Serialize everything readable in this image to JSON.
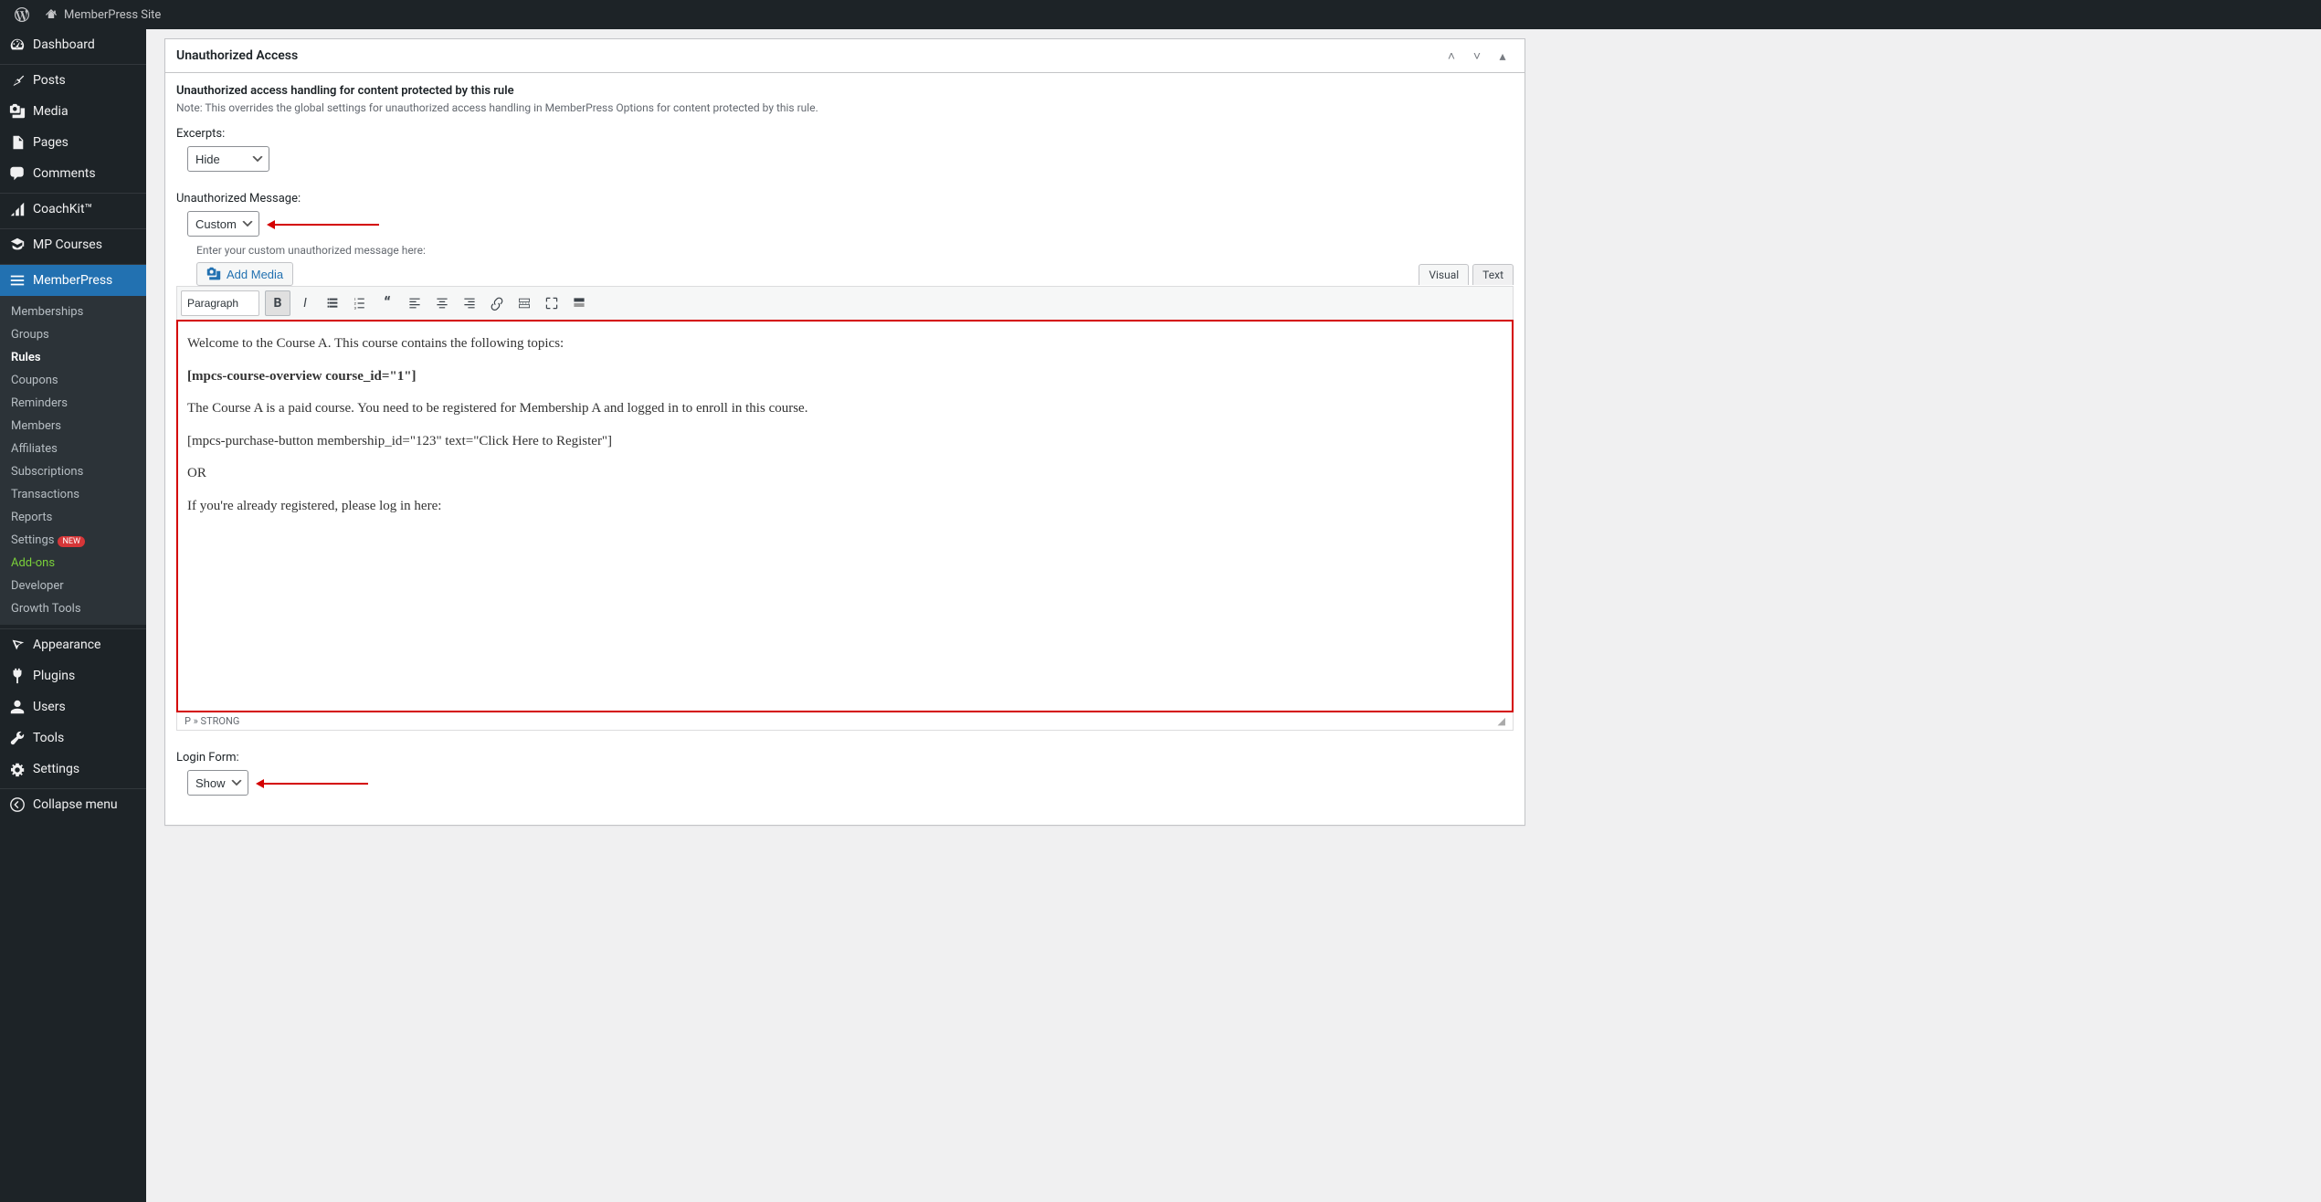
{
  "adminbar": {
    "site_name": "MemberPress Site"
  },
  "sidebar": {
    "items": [
      {
        "label": "Dashboard",
        "icon": "dashboard"
      },
      {
        "label": "Posts",
        "icon": "pin"
      },
      {
        "label": "Media",
        "icon": "media"
      },
      {
        "label": "Pages",
        "icon": "pages"
      },
      {
        "label": "Comments",
        "icon": "comments"
      },
      {
        "label": "CoachKit™",
        "icon": "chart"
      },
      {
        "label": "MP Courses",
        "icon": "courses"
      },
      {
        "label": "MemberPress",
        "icon": "mp",
        "current": true
      }
    ],
    "submenu": [
      {
        "label": "Memberships"
      },
      {
        "label": "Groups"
      },
      {
        "label": "Rules",
        "current": true
      },
      {
        "label": "Coupons"
      },
      {
        "label": "Reminders"
      },
      {
        "label": "Members"
      },
      {
        "label": "Affiliates"
      },
      {
        "label": "Subscriptions"
      },
      {
        "label": "Transactions"
      },
      {
        "label": "Reports"
      },
      {
        "label": "Settings",
        "badge": "NEW"
      },
      {
        "label": "Add-ons",
        "addon": true
      },
      {
        "label": "Developer"
      },
      {
        "label": "Growth Tools"
      }
    ],
    "bottom": [
      {
        "label": "Appearance",
        "icon": "appearance"
      },
      {
        "label": "Plugins",
        "icon": "plugins"
      },
      {
        "label": "Users",
        "icon": "users"
      },
      {
        "label": "Tools",
        "icon": "tools"
      },
      {
        "label": "Settings",
        "icon": "settings"
      },
      {
        "label": "Collapse menu",
        "icon": "collapse"
      }
    ]
  },
  "panel": {
    "title": "Unauthorized Access",
    "section_title": "Unauthorized access handling for content protected by this rule",
    "note": "Note: This overrides the global settings for unauthorized access handling in MemberPress Options for content protected by this rule.",
    "excerpts_label": "Excerpts:",
    "excerpts_value": "Hide",
    "unauth_msg_label": "Unauthorized Message:",
    "unauth_msg_value": "Custom",
    "editor_helper": "Enter your custom unauthorized message here:",
    "add_media": "Add Media",
    "tabs": {
      "visual": "Visual",
      "text": "Text"
    },
    "format_select": "Paragraph",
    "editor_content": {
      "p1": "Welcome to the Course A. This course contains the following topics:",
      "p2_strong": "[mpcs-course-overview course_id=\"1\"]",
      "p3": "The Course A is a paid course. You need to be registered for Membership A and logged in to enroll in this course.",
      "p4": "[mpcs-purchase-button membership_id=\"123\" text=\"Click Here to Register\"]",
      "p5": "OR",
      "p6": "If you're already registered, please log in here:"
    },
    "statusbar_path": "P » STRONG",
    "login_form_label": "Login Form:",
    "login_form_value": "Show"
  }
}
